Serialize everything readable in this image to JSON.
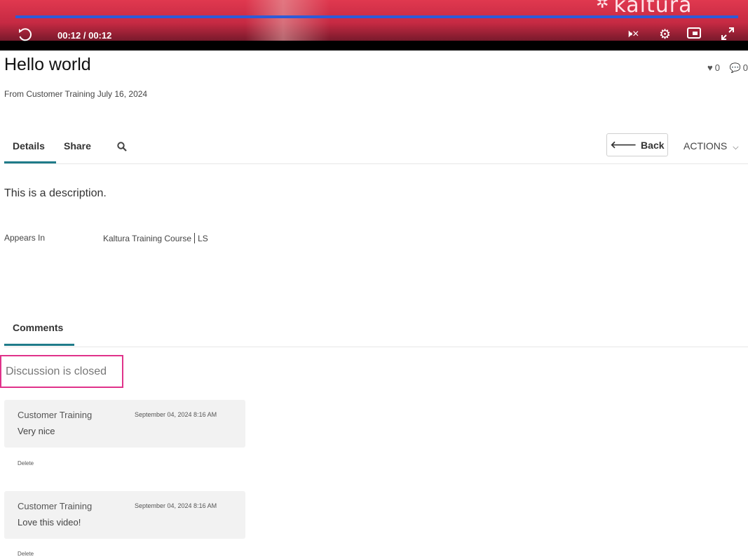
{
  "player": {
    "time": "00:12 / 00:12",
    "progress": 1.0,
    "logo_text": "kaltura",
    "accent_color": "#2e5bd8",
    "icons": [
      "replay-icon",
      "mute-icon",
      "gear-icon",
      "pip-icon",
      "fullscreen-icon"
    ]
  },
  "media": {
    "title": "Hello world",
    "likes": "0",
    "comments_count": "0",
    "subtitle": "From Customer Training July 16, 2024"
  },
  "tabs": {
    "details": "Details",
    "share": "Share",
    "back": "Back",
    "actions": "ACTIONS"
  },
  "details": {
    "description": "This is a description.",
    "appears_label": "Appears In",
    "appears_course": "Kaltura Training Course",
    "appears_suffix": "LS"
  },
  "comments": {
    "tab_label": "Comments",
    "closed_message": "Discussion is closed",
    "items": [
      {
        "author": "Customer Training",
        "date": "September 04, 2024 8:16 AM",
        "text": "Very nice",
        "delete": "Delete"
      },
      {
        "author": "Customer Training",
        "date": "September 04, 2024 8:16 AM",
        "text": "Love this video!",
        "delete": "Delete"
      }
    ]
  }
}
